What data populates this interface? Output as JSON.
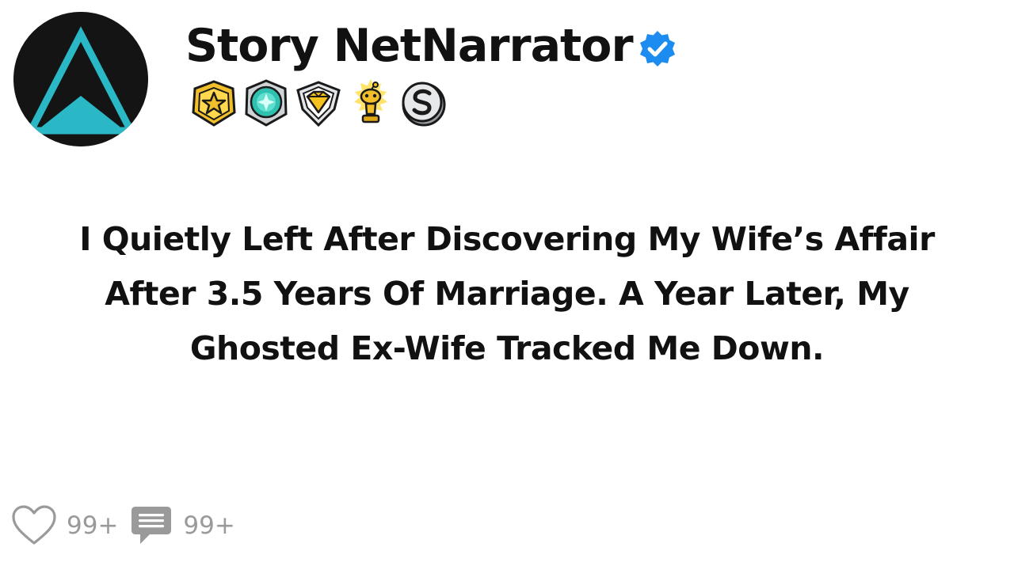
{
  "post": {
    "author": {
      "name": "Story NetNarrator",
      "verified": true,
      "avatar_icon": "cyan-triangle-logo-icon",
      "badges": [
        {
          "icon": "gold-star-medal-icon"
        },
        {
          "icon": "teal-gem-medal-icon"
        },
        {
          "icon": "gold-diamond-shield-badge-icon"
        },
        {
          "icon": "golden-snoo-trophy-icon"
        },
        {
          "icon": "silver-s-coin-icon"
        }
      ]
    },
    "title": "I Quietly Left After Discovering My Wife’s Affair After 3.5 Years Of Marriage. A Year Later, My Ghosted Ex-Wife Tracked Me Down.",
    "stats": {
      "likes": "99+",
      "comments": "99+"
    }
  },
  "colors": {
    "avatar_bg": "#141414",
    "logo_accent": "#2ab8c6",
    "verified_blue": "#1d8cf0",
    "text": "#111111",
    "muted": "#9a9a9a"
  }
}
